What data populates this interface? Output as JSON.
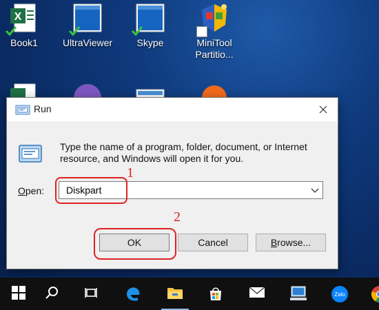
{
  "desktop": {
    "icons": [
      {
        "label": "Book1",
        "icon": "excel-icon"
      },
      {
        "label": "UltraViewer",
        "icon": "ultraviewer-icon"
      },
      {
        "label": "Skype",
        "icon": "skype-icon"
      },
      {
        "label": "MiniTool Partitio...",
        "icon": "minitool-icon"
      },
      {
        "label": "",
        "icon": "excel-icon"
      },
      {
        "label": "",
        "icon": "viber-icon"
      },
      {
        "label": "",
        "icon": "app-icon"
      },
      {
        "label": "",
        "icon": "avast-icon"
      }
    ]
  },
  "run_dialog": {
    "title": "Run",
    "description": "Type the name of a program, folder, document, or Internet resource, and Windows will open it for you.",
    "open_label_accel": "O",
    "open_label_rest": "pen:",
    "input_value": "Diskpart",
    "ok_label": "OK",
    "cancel_label": "Cancel",
    "browse_label_accel": "B",
    "browse_label_rest": "rowse..."
  },
  "annotations": {
    "step1": "1",
    "step2": "2",
    "color": "#e02020"
  },
  "taskbar": {
    "items": [
      {
        "icon": "windows-start-icon"
      },
      {
        "icon": "search-icon"
      },
      {
        "icon": "task-view-icon"
      },
      {
        "icon": "edge-icon"
      },
      {
        "icon": "file-explorer-icon"
      },
      {
        "icon": "store-icon"
      },
      {
        "icon": "mail-icon"
      },
      {
        "icon": "network-pc-icon"
      },
      {
        "icon": "zalo-icon",
        "text": "Zalo"
      },
      {
        "icon": "chrome-icon"
      }
    ]
  }
}
